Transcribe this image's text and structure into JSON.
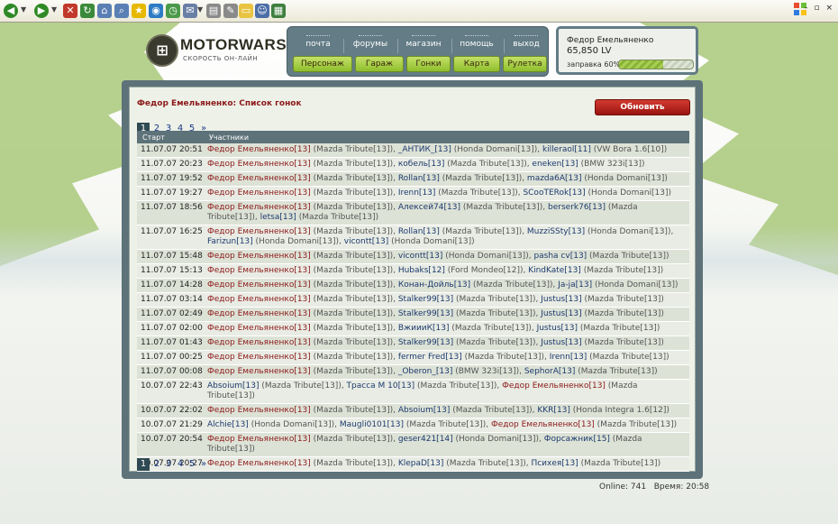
{
  "site": {
    "logo_text": "MOTORWARS.RU",
    "tagline": "СКОРОСТЬ ОН-ЛАЙН"
  },
  "top_nav": [
    "почта",
    "форумы",
    "магазин",
    "помощь",
    "выход"
  ],
  "main_nav": [
    "Персонаж",
    "Гараж",
    "Гонки",
    "Карта",
    "Рулетка"
  ],
  "user": {
    "name": "Федор Емельяненко",
    "money": "65,850 LV",
    "fuel_label": "заправка 60%",
    "fuel_percent": 60
  },
  "panel": {
    "title": "Федор Емельяненко: Список гонок",
    "refresh_label": "Обновить",
    "pages": [
      "1",
      "2",
      "3",
      "4",
      "5",
      "»"
    ],
    "active_page": "1",
    "columns": [
      "Старт",
      "Участники"
    ],
    "me": "Федор Емельяненко",
    "rows": [
      {
        "time": "11.07.07 20:51",
        "participants": [
          {
            "name": "Федор Емельяненко",
            "lvl": "[13]",
            "car": "(Mazda Tribute[13])"
          },
          {
            "name": "_АНТИК_",
            "lvl": "[13]",
            "car": "(Honda Domani[13])"
          },
          {
            "name": "killeraol",
            "lvl": "[11]",
            "car": "(VW Bora 1.6[10])"
          }
        ]
      },
      {
        "time": "11.07.07 20:23",
        "participants": [
          {
            "name": "Федор Емельяненко",
            "lvl": "[13]",
            "car": "(Mazda Tribute[13])"
          },
          {
            "name": "кобель",
            "lvl": "[13]",
            "car": "(Mazda Tribute[13])"
          },
          {
            "name": "eneken",
            "lvl": "[13]",
            "car": "(BMW 323i[13])"
          }
        ]
      },
      {
        "time": "11.07.07 19:52",
        "participants": [
          {
            "name": "Федор Емельяненко",
            "lvl": "[13]",
            "car": "(Mazda Tribute[13])"
          },
          {
            "name": "Rollan",
            "lvl": "[13]",
            "car": "(Mazda Tribute[13])"
          },
          {
            "name": "mazda6A",
            "lvl": "[13]",
            "car": "(Honda Domani[13])"
          }
        ]
      },
      {
        "time": "11.07.07 19:27",
        "participants": [
          {
            "name": "Федор Емельяненко",
            "lvl": "[13]",
            "car": "(Mazda Tribute[13])"
          },
          {
            "name": "Irenn",
            "lvl": "[13]",
            "car": "(Mazda Tribute[13])"
          },
          {
            "name": "SCooTERok",
            "lvl": "[13]",
            "car": "(Honda Domani[13])"
          }
        ]
      },
      {
        "time": "11.07.07 18:56",
        "participants": [
          {
            "name": "Федор Емельяненко",
            "lvl": "[13]",
            "car": "(Mazda Tribute[13])"
          },
          {
            "name": "Алексей74",
            "lvl": "[13]",
            "car": "(Mazda Tribute[13])"
          },
          {
            "name": "berserk76",
            "lvl": "[13]",
            "car": "(Mazda Tribute[13])"
          },
          {
            "name": "letsa",
            "lvl": "[13]",
            "car": "(Mazda Tribute[13])"
          }
        ]
      },
      {
        "time": "11.07.07 16:25",
        "participants": [
          {
            "name": "Федор Емельяненко",
            "lvl": "[13]",
            "car": "(Mazda Tribute[13])"
          },
          {
            "name": "Rollan",
            "lvl": "[13]",
            "car": "(Mazda Tribute[13])"
          },
          {
            "name": "MuzziSSty",
            "lvl": "[13]",
            "car": "(Honda Domani[13])"
          },
          {
            "name": "Farizun",
            "lvl": "[13]",
            "car": "(Honda Domani[13])"
          },
          {
            "name": "vicontt",
            "lvl": "[13]",
            "car": "(Honda Domani[13])"
          }
        ]
      },
      {
        "time": "11.07.07 15:48",
        "participants": [
          {
            "name": "Федор Емельяненко",
            "lvl": "[13]",
            "car": "(Mazda Tribute[13])"
          },
          {
            "name": "vicontt",
            "lvl": "[13]",
            "car": "(Honda Domani[13])"
          },
          {
            "name": "pasha cv",
            "lvl": "[13]",
            "car": "(Mazda Tribute[13])"
          }
        ]
      },
      {
        "time": "11.07.07 15:13",
        "participants": [
          {
            "name": "Федор Емельяненко",
            "lvl": "[13]",
            "car": "(Mazda Tribute[13])"
          },
          {
            "name": "Hubaks",
            "lvl": "[12]",
            "car": "(Ford Mondeo[12])"
          },
          {
            "name": "KindKate",
            "lvl": "[13]",
            "car": "(Mazda Tribute[13])"
          }
        ]
      },
      {
        "time": "11.07.07 14:28",
        "participants": [
          {
            "name": "Федор Емельяненко",
            "lvl": "[13]",
            "car": "(Mazda Tribute[13])"
          },
          {
            "name": "Конан-Дойль",
            "lvl": "[13]",
            "car": "(Mazda Tribute[13])"
          },
          {
            "name": "Ja-ja",
            "lvl": "[13]",
            "car": "(Honda Domani[13])"
          }
        ]
      },
      {
        "time": "11.07.07 03:14",
        "participants": [
          {
            "name": "Федор Емельяненко",
            "lvl": "[13]",
            "car": "(Mazda Tribute[13])"
          },
          {
            "name": "Stalker99",
            "lvl": "[13]",
            "car": "(Mazda Tribute[13])"
          },
          {
            "name": "Justus",
            "lvl": "[13]",
            "car": "(Mazda Tribute[13])"
          }
        ]
      },
      {
        "time": "11.07.07 02:49",
        "participants": [
          {
            "name": "Федор Емельяненко",
            "lvl": "[13]",
            "car": "(Mazda Tribute[13])"
          },
          {
            "name": "Stalker99",
            "lvl": "[13]",
            "car": "(Mazda Tribute[13])"
          },
          {
            "name": "Justus",
            "lvl": "[13]",
            "car": "(Mazda Tribute[13])"
          }
        ]
      },
      {
        "time": "11.07.07 02:00",
        "participants": [
          {
            "name": "Федор Емельяненко",
            "lvl": "[13]",
            "car": "(Mazda Tribute[13])"
          },
          {
            "name": "ВжиииК",
            "lvl": "[13]",
            "car": "(Mazda Tribute[13])"
          },
          {
            "name": "Justus",
            "lvl": "[13]",
            "car": "(Mazda Tribute[13])"
          }
        ]
      },
      {
        "time": "11.07.07 01:43",
        "participants": [
          {
            "name": "Федор Емельяненко",
            "lvl": "[13]",
            "car": "(Mazda Tribute[13])"
          },
          {
            "name": "Stalker99",
            "lvl": "[13]",
            "car": "(Mazda Tribute[13])"
          },
          {
            "name": "Justus",
            "lvl": "[13]",
            "car": "(Mazda Tribute[13])"
          }
        ]
      },
      {
        "time": "11.07.07 00:25",
        "participants": [
          {
            "name": "Федор Емельяненко",
            "lvl": "[13]",
            "car": "(Mazda Tribute[13])"
          },
          {
            "name": "fermer Fred",
            "lvl": "[13]",
            "car": "(Mazda Tribute[13])"
          },
          {
            "name": "Irenn",
            "lvl": "[13]",
            "car": "(Mazda Tribute[13])"
          }
        ]
      },
      {
        "time": "11.07.07 00:08",
        "participants": [
          {
            "name": "Федор Емельяненко",
            "lvl": "[13]",
            "car": "(Mazda Tribute[13])"
          },
          {
            "name": "_Oberon_",
            "lvl": "[13]",
            "car": "(BMW 323i[13])"
          },
          {
            "name": "SephorA",
            "lvl": "[13]",
            "car": "(Mazda Tribute[13])"
          }
        ]
      },
      {
        "time": "10.07.07 22:43",
        "participants": [
          {
            "name": "Absoium",
            "lvl": "[13]",
            "car": "(Mazda Tribute[13])"
          },
          {
            "name": "Трасса М 10",
            "lvl": "[13]",
            "car": "(Mazda Tribute[13])"
          },
          {
            "name": "Федор Емельяненко",
            "lvl": "[13]",
            "car": "(Mazda Tribute[13])"
          }
        ]
      },
      {
        "time": "10.07.07 22:02",
        "participants": [
          {
            "name": "Федор Емельяненко",
            "lvl": "[13]",
            "car": "(Mazda Tribute[13])"
          },
          {
            "name": "Absoium",
            "lvl": "[13]",
            "car": "(Mazda Tribute[13])"
          },
          {
            "name": "KKR",
            "lvl": "[13]",
            "car": "(Honda Integra 1.6[12])"
          }
        ]
      },
      {
        "time": "10.07.07 21:29",
        "participants": [
          {
            "name": "Alchie",
            "lvl": "[13]",
            "car": "(Honda Domani[13])"
          },
          {
            "name": "Maugli0101",
            "lvl": "[13]",
            "car": "(Mazda Tribute[13])"
          },
          {
            "name": "Федор Емельяненко",
            "lvl": "[13]",
            "car": "(Mazda Tribute[13])"
          }
        ]
      },
      {
        "time": "10.07.07 20:54",
        "participants": [
          {
            "name": "Федор Емельяненко",
            "lvl": "[13]",
            "car": "(Mazda Tribute[13])"
          },
          {
            "name": "geser421",
            "lvl": "[14]",
            "car": "(Honda Domani[13])"
          },
          {
            "name": "Форсажник",
            "lvl": "[15]",
            "car": "(Mazda Tribute[13])"
          }
        ]
      },
      {
        "time": "10.07.07 20:27",
        "participants": [
          {
            "name": "Федор Емельяненко",
            "lvl": "[13]",
            "car": "(Mazda Tribute[13])"
          },
          {
            "name": "KlepaD",
            "lvl": "[13]",
            "car": "(Mazda Tribute[13])"
          },
          {
            "name": "Психея",
            "lvl": "[13]",
            "car": "(Mazda Tribute[13])"
          }
        ]
      }
    ]
  },
  "status": {
    "online": "Online: 741",
    "time": "Время: 20:58"
  }
}
